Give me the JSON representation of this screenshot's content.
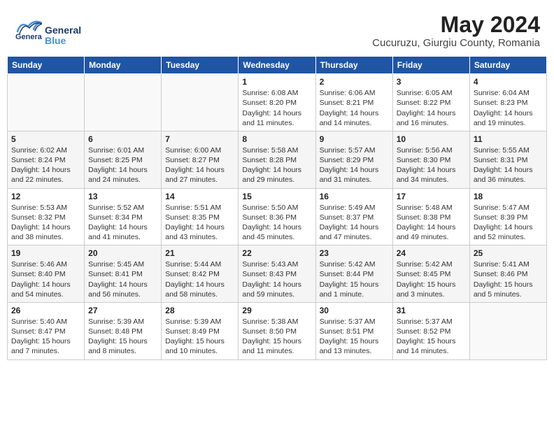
{
  "header": {
    "logo_general": "General",
    "logo_blue": "Blue",
    "month_year": "May 2024",
    "location": "Cucuruzu, Giurgiu County, Romania"
  },
  "weekdays": [
    "Sunday",
    "Monday",
    "Tuesday",
    "Wednesday",
    "Thursday",
    "Friday",
    "Saturday"
  ],
  "weeks": [
    [
      {
        "day": "",
        "sunrise": "",
        "sunset": "",
        "daylight": ""
      },
      {
        "day": "",
        "sunrise": "",
        "sunset": "",
        "daylight": ""
      },
      {
        "day": "",
        "sunrise": "",
        "sunset": "",
        "daylight": ""
      },
      {
        "day": "1",
        "sunrise": "Sunrise: 6:08 AM",
        "sunset": "Sunset: 8:20 PM",
        "daylight": "Daylight: 14 hours and 11 minutes."
      },
      {
        "day": "2",
        "sunrise": "Sunrise: 6:06 AM",
        "sunset": "Sunset: 8:21 PM",
        "daylight": "Daylight: 14 hours and 14 minutes."
      },
      {
        "day": "3",
        "sunrise": "Sunrise: 6:05 AM",
        "sunset": "Sunset: 8:22 PM",
        "daylight": "Daylight: 14 hours and 16 minutes."
      },
      {
        "day": "4",
        "sunrise": "Sunrise: 6:04 AM",
        "sunset": "Sunset: 8:23 PM",
        "daylight": "Daylight: 14 hours and 19 minutes."
      }
    ],
    [
      {
        "day": "5",
        "sunrise": "Sunrise: 6:02 AM",
        "sunset": "Sunset: 8:24 PM",
        "daylight": "Daylight: 14 hours and 22 minutes."
      },
      {
        "day": "6",
        "sunrise": "Sunrise: 6:01 AM",
        "sunset": "Sunset: 8:25 PM",
        "daylight": "Daylight: 14 hours and 24 minutes."
      },
      {
        "day": "7",
        "sunrise": "Sunrise: 6:00 AM",
        "sunset": "Sunset: 8:27 PM",
        "daylight": "Daylight: 14 hours and 27 minutes."
      },
      {
        "day": "8",
        "sunrise": "Sunrise: 5:58 AM",
        "sunset": "Sunset: 8:28 PM",
        "daylight": "Daylight: 14 hours and 29 minutes."
      },
      {
        "day": "9",
        "sunrise": "Sunrise: 5:57 AM",
        "sunset": "Sunset: 8:29 PM",
        "daylight": "Daylight: 14 hours and 31 minutes."
      },
      {
        "day": "10",
        "sunrise": "Sunrise: 5:56 AM",
        "sunset": "Sunset: 8:30 PM",
        "daylight": "Daylight: 14 hours and 34 minutes."
      },
      {
        "day": "11",
        "sunrise": "Sunrise: 5:55 AM",
        "sunset": "Sunset: 8:31 PM",
        "daylight": "Daylight: 14 hours and 36 minutes."
      }
    ],
    [
      {
        "day": "12",
        "sunrise": "Sunrise: 5:53 AM",
        "sunset": "Sunset: 8:32 PM",
        "daylight": "Daylight: 14 hours and 38 minutes."
      },
      {
        "day": "13",
        "sunrise": "Sunrise: 5:52 AM",
        "sunset": "Sunset: 8:34 PM",
        "daylight": "Daylight: 14 hours and 41 minutes."
      },
      {
        "day": "14",
        "sunrise": "Sunrise: 5:51 AM",
        "sunset": "Sunset: 8:35 PM",
        "daylight": "Daylight: 14 hours and 43 minutes."
      },
      {
        "day": "15",
        "sunrise": "Sunrise: 5:50 AM",
        "sunset": "Sunset: 8:36 PM",
        "daylight": "Daylight: 14 hours and 45 minutes."
      },
      {
        "day": "16",
        "sunrise": "Sunrise: 5:49 AM",
        "sunset": "Sunset: 8:37 PM",
        "daylight": "Daylight: 14 hours and 47 minutes."
      },
      {
        "day": "17",
        "sunrise": "Sunrise: 5:48 AM",
        "sunset": "Sunset: 8:38 PM",
        "daylight": "Daylight: 14 hours and 49 minutes."
      },
      {
        "day": "18",
        "sunrise": "Sunrise: 5:47 AM",
        "sunset": "Sunset: 8:39 PM",
        "daylight": "Daylight: 14 hours and 52 minutes."
      }
    ],
    [
      {
        "day": "19",
        "sunrise": "Sunrise: 5:46 AM",
        "sunset": "Sunset: 8:40 PM",
        "daylight": "Daylight: 14 hours and 54 minutes."
      },
      {
        "day": "20",
        "sunrise": "Sunrise: 5:45 AM",
        "sunset": "Sunset: 8:41 PM",
        "daylight": "Daylight: 14 hours and 56 minutes."
      },
      {
        "day": "21",
        "sunrise": "Sunrise: 5:44 AM",
        "sunset": "Sunset: 8:42 PM",
        "daylight": "Daylight: 14 hours and 58 minutes."
      },
      {
        "day": "22",
        "sunrise": "Sunrise: 5:43 AM",
        "sunset": "Sunset: 8:43 PM",
        "daylight": "Daylight: 14 hours and 59 minutes."
      },
      {
        "day": "23",
        "sunrise": "Sunrise: 5:42 AM",
        "sunset": "Sunset: 8:44 PM",
        "daylight": "Daylight: 15 hours and 1 minute."
      },
      {
        "day": "24",
        "sunrise": "Sunrise: 5:42 AM",
        "sunset": "Sunset: 8:45 PM",
        "daylight": "Daylight: 15 hours and 3 minutes."
      },
      {
        "day": "25",
        "sunrise": "Sunrise: 5:41 AM",
        "sunset": "Sunset: 8:46 PM",
        "daylight": "Daylight: 15 hours and 5 minutes."
      }
    ],
    [
      {
        "day": "26",
        "sunrise": "Sunrise: 5:40 AM",
        "sunset": "Sunset: 8:47 PM",
        "daylight": "Daylight: 15 hours and 7 minutes."
      },
      {
        "day": "27",
        "sunrise": "Sunrise: 5:39 AM",
        "sunset": "Sunset: 8:48 PM",
        "daylight": "Daylight: 15 hours and 8 minutes."
      },
      {
        "day": "28",
        "sunrise": "Sunrise: 5:39 AM",
        "sunset": "Sunset: 8:49 PM",
        "daylight": "Daylight: 15 hours and 10 minutes."
      },
      {
        "day": "29",
        "sunrise": "Sunrise: 5:38 AM",
        "sunset": "Sunset: 8:50 PM",
        "daylight": "Daylight: 15 hours and 11 minutes."
      },
      {
        "day": "30",
        "sunrise": "Sunrise: 5:37 AM",
        "sunset": "Sunset: 8:51 PM",
        "daylight": "Daylight: 15 hours and 13 minutes."
      },
      {
        "day": "31",
        "sunrise": "Sunrise: 5:37 AM",
        "sunset": "Sunset: 8:52 PM",
        "daylight": "Daylight: 15 hours and 14 minutes."
      },
      {
        "day": "",
        "sunrise": "",
        "sunset": "",
        "daylight": ""
      }
    ]
  ]
}
